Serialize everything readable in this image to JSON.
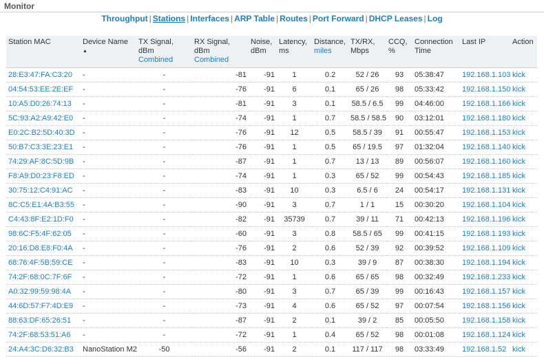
{
  "section_title": "Monitor",
  "nav": [
    {
      "label": "Throughput",
      "active": false
    },
    {
      "label": "Stations",
      "active": true
    },
    {
      "label": "Interfaces",
      "active": false
    },
    {
      "label": "ARP Table",
      "active": false
    },
    {
      "label": "Routes",
      "active": false
    },
    {
      "label": "Port Forward",
      "active": false
    },
    {
      "label": "DHCP Leases",
      "active": false
    },
    {
      "label": "Log",
      "active": false
    }
  ],
  "nav_separator": "|",
  "table": {
    "headers": {
      "mac": "Station MAC",
      "device": "Device Name",
      "tx": "TX Signal, dBm",
      "tx_sub": "Combined",
      "rx": "RX Signal, dBm",
      "rx_sub": "Combined",
      "noise": "Noise,",
      "noise_sub": "dBm",
      "latency": "Latency,",
      "latency_sub": "ms",
      "distance": "Distance,",
      "distance_sub": "miles",
      "txrx": "TX/RX,",
      "txrx_sub": "Mbps",
      "ccq": "CCQ,",
      "ccq_sub": "%",
      "conn": "Connection",
      "conn_sub": "Time",
      "ip": "Last IP",
      "action": "Action"
    },
    "sort_icon": "sort-ascending-icon",
    "rows": [
      {
        "mac": "28:E3:47:FA:C3:20",
        "device": "-",
        "tx": "-",
        "rx": "-81",
        "noise": "-91",
        "latency": "1",
        "distance": "0.2",
        "txrx": "52 / 26",
        "ccq": "93",
        "time": "05:38:47",
        "ip": "192.168.1.103",
        "action": "kick"
      },
      {
        "mac": "04:54:53:EE:2E:EF",
        "device": "-",
        "tx": "-",
        "rx": "-76",
        "noise": "-91",
        "latency": "6",
        "distance": "0.1",
        "txrx": "65 / 26",
        "ccq": "98",
        "time": "05:33:42",
        "ip": "192.168.1.150",
        "action": "kick"
      },
      {
        "mac": "10:A5:D0:26:74:13",
        "device": "-",
        "tx": "-",
        "rx": "-81",
        "noise": "-91",
        "latency": "3",
        "distance": "0.1",
        "txrx": "58.5 / 6.5",
        "ccq": "99",
        "time": "04:46:00",
        "ip": "192.168.1.166",
        "action": "kick"
      },
      {
        "mac": "5C:93:A2:A9:42:E0",
        "device": "-",
        "tx": "-",
        "rx": "-74",
        "noise": "-91",
        "latency": "1",
        "distance": "0.7",
        "txrx": "58.5 / 58.5",
        "ccq": "90",
        "time": "03:12:01",
        "ip": "192.168.1.180",
        "action": "kick"
      },
      {
        "mac": "E0:2C:B2:5D:40:3D",
        "device": "-",
        "tx": "-",
        "rx": "-76",
        "noise": "-91",
        "latency": "12",
        "distance": "0.5",
        "txrx": "58.5 / 39",
        "ccq": "91",
        "time": "00:55:47",
        "ip": "192.168.1.153",
        "action": "kick"
      },
      {
        "mac": "50:B7:C3:3E:23:E1",
        "device": "-",
        "tx": "-",
        "rx": "-76",
        "noise": "-91",
        "latency": "1",
        "distance": "0.5",
        "txrx": "65 / 19.5",
        "ccq": "97",
        "time": "01:32:04",
        "ip": "192.168.1.140",
        "action": "kick"
      },
      {
        "mac": "74:29:AF:8C:5D:9B",
        "device": "-",
        "tx": "-",
        "rx": "-87",
        "noise": "-91",
        "latency": "1",
        "distance": "0.7",
        "txrx": "13 / 13",
        "ccq": "89",
        "time": "00:56:07",
        "ip": "192.168.1.160",
        "action": "kick"
      },
      {
        "mac": "F8:A9:D0:23:F8:ED",
        "device": "-",
        "tx": "-",
        "rx": "-74",
        "noise": "-91",
        "latency": "1",
        "distance": "0.3",
        "txrx": "65 / 52",
        "ccq": "99",
        "time": "00:54:43",
        "ip": "192.168.1.185",
        "action": "kick"
      },
      {
        "mac": "30:75:12:C4:91:AC",
        "device": "-",
        "tx": "-",
        "rx": "-83",
        "noise": "-91",
        "latency": "10",
        "distance": "0.3",
        "txrx": "6.5 / 6",
        "ccq": "24",
        "time": "00:54:17",
        "ip": "192.168.1.131",
        "action": "kick"
      },
      {
        "mac": "8C:C5:E1:4A:B3:55",
        "device": "-",
        "tx": "-",
        "rx": "-90",
        "noise": "-91",
        "latency": "3",
        "distance": "0.7",
        "txrx": "1 / 1",
        "ccq": "15",
        "time": "00:30:20",
        "ip": "192.168.1.104",
        "action": "kick"
      },
      {
        "mac": "C4:43:8F:E2:1D:F0",
        "device": "-",
        "tx": "-",
        "rx": "-82",
        "noise": "-91",
        "latency": "35739",
        "distance": "0.7",
        "txrx": "39 / 11",
        "ccq": "71",
        "time": "00:42:13",
        "ip": "192.168.1.196",
        "action": "kick"
      },
      {
        "mac": "98:6C:F5:4F:62:05",
        "device": "-",
        "tx": "-",
        "rx": "-60",
        "noise": "-91",
        "latency": "3",
        "distance": "0.8",
        "txrx": "58.5 / 65",
        "ccq": "99",
        "time": "00:41:15",
        "ip": "192.168.1.193",
        "action": "kick"
      },
      {
        "mac": "20:16:D8:E8:F0:4A",
        "device": "-",
        "tx": "-",
        "rx": "-76",
        "noise": "-91",
        "latency": "2",
        "distance": "0.6",
        "txrx": "52 / 39",
        "ccq": "92",
        "time": "00:39:52",
        "ip": "192.168.1.109",
        "action": "kick"
      },
      {
        "mac": "68:76:4F:5B:59:CE",
        "device": "-",
        "tx": "-",
        "rx": "-83",
        "noise": "-91",
        "latency": "10",
        "distance": "0.3",
        "txrx": "39 / 9",
        "ccq": "87",
        "time": "00:38:30",
        "ip": "192.168.1.194",
        "action": "kick"
      },
      {
        "mac": "74:2F:68:0C:7F:6F",
        "device": "-",
        "tx": "-",
        "rx": "-72",
        "noise": "-91",
        "latency": "1",
        "distance": "0.6",
        "txrx": "65 / 65",
        "ccq": "98",
        "time": "00:32:49",
        "ip": "192.168.1.233",
        "action": "kick"
      },
      {
        "mac": "A0:32:99:59:98:4A",
        "device": "-",
        "tx": "-",
        "rx": "-80",
        "noise": "-91",
        "latency": "3",
        "distance": "0.7",
        "txrx": "65 / 39",
        "ccq": "99",
        "time": "00:16:43",
        "ip": "192.168.1.157",
        "action": "kick"
      },
      {
        "mac": "44:6D:57:F7:4D:E9",
        "device": "-",
        "tx": "-",
        "rx": "-73",
        "noise": "-91",
        "latency": "4",
        "distance": "0.6",
        "txrx": "65 / 52",
        "ccq": "97",
        "time": "00:07:54",
        "ip": "192.168.1.156",
        "action": "kick"
      },
      {
        "mac": "88:63:DF:65:26:51",
        "device": "-",
        "tx": "-",
        "rx": "-87",
        "noise": "-91",
        "latency": "2",
        "distance": "0.1",
        "txrx": "39 / 2",
        "ccq": "85",
        "time": "00:05:50",
        "ip": "192.168.1.158",
        "action": "kick"
      },
      {
        "mac": "74:2F:68:53:51:A6",
        "device": "-",
        "tx": "-",
        "rx": "-72",
        "noise": "-91",
        "latency": "1",
        "distance": "0.4",
        "txrx": "65 / 52",
        "ccq": "98",
        "time": "00:01:08",
        "ip": "192.168.1.124",
        "action": "kick"
      },
      {
        "mac": "24:A4:3C:D6:32:B3",
        "device": "NanoStation M2",
        "tx": "-50",
        "rx": "-56",
        "noise": "-91",
        "latency": "2",
        "distance": "0.1",
        "txrx": "117 / 117",
        "ccq": "98",
        "time": "03:33:49",
        "ip": "192.168.1.52",
        "action": "kick"
      }
    ]
  }
}
